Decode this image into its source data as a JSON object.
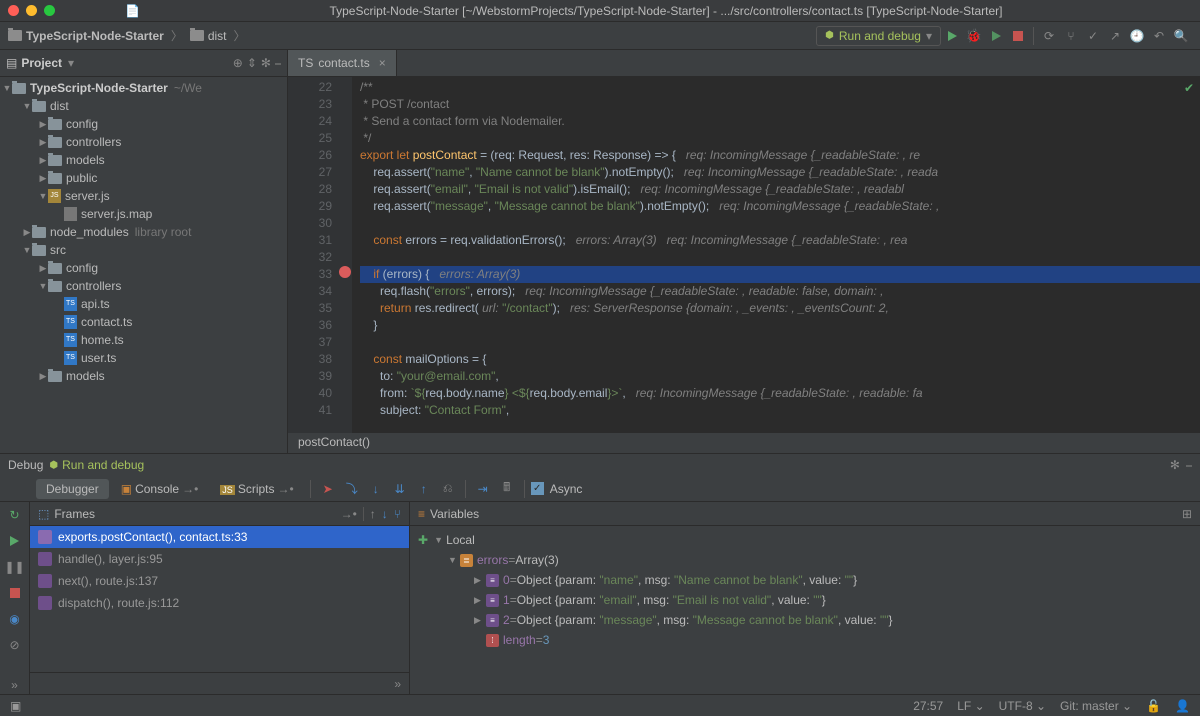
{
  "window": {
    "title": "TypeScript-Node-Starter [~/WebstormProjects/TypeScript-Node-Starter] - .../src/controllers/contact.ts [TypeScript-Node-Starter]"
  },
  "breadcrumb": {
    "root": "TypeScript-Node-Starter",
    "sub": "dist"
  },
  "run": {
    "config": "Run and debug",
    "async_label": "Async"
  },
  "sidebar": {
    "title": "Project",
    "root": {
      "label": "TypeScript-Node-Starter",
      "path": "~/We"
    },
    "tree": [
      {
        "depth": 1,
        "arrow": "down",
        "icon": "folder",
        "label": "dist"
      },
      {
        "depth": 2,
        "arrow": "right",
        "icon": "folder",
        "label": "config"
      },
      {
        "depth": 2,
        "arrow": "right",
        "icon": "folder",
        "label": "controllers"
      },
      {
        "depth": 2,
        "arrow": "right",
        "icon": "folder",
        "label": "models"
      },
      {
        "depth": 2,
        "arrow": "right",
        "icon": "folder",
        "label": "public"
      },
      {
        "depth": 2,
        "arrow": "down",
        "icon": "js",
        "label": "server.js"
      },
      {
        "depth": 3,
        "arrow": "",
        "icon": "file",
        "label": "server.js.map"
      },
      {
        "depth": 1,
        "arrow": "right",
        "icon": "folder",
        "label": "node_modules",
        "suffix": "library root"
      },
      {
        "depth": 1,
        "arrow": "down",
        "icon": "folder",
        "label": "src"
      },
      {
        "depth": 2,
        "arrow": "right",
        "icon": "folder",
        "label": "config"
      },
      {
        "depth": 2,
        "arrow": "down",
        "icon": "folder",
        "label": "controllers"
      },
      {
        "depth": 3,
        "arrow": "",
        "icon": "ts",
        "label": "api.ts"
      },
      {
        "depth": 3,
        "arrow": "",
        "icon": "ts",
        "label": "contact.ts"
      },
      {
        "depth": 3,
        "arrow": "",
        "icon": "ts",
        "label": "home.ts"
      },
      {
        "depth": 3,
        "arrow": "",
        "icon": "ts",
        "label": "user.ts"
      },
      {
        "depth": 2,
        "arrow": "right",
        "icon": "folder",
        "label": "models"
      }
    ]
  },
  "editor": {
    "tab": "contact.ts",
    "first_line": 22,
    "crumb": "postContact()",
    "lines": [
      {
        "n": 22,
        "html": "<span class='c-cm'>/**</span>"
      },
      {
        "n": 23,
        "html": "<span class='c-cm'> * POST /contact</span>"
      },
      {
        "n": 24,
        "html": "<span class='c-cm'> * Send a contact form via Nodemailer.</span>"
      },
      {
        "n": 25,
        "html": "<span class='c-cm'> */</span>"
      },
      {
        "n": 26,
        "html": "<span class='c-kw'>export let</span> <span class='c-fn'>postContact</span> = (req: Request, res: Response) =&gt; {   <span class='c-hint'>req: IncomingMessage {_readableState: , re</span>"
      },
      {
        "n": 27,
        "html": "    req.assert(<span class='c-str'>\"name\"</span>, <span class='c-str'>\"Name cannot be blank\"</span>).notEmpty();   <span class='c-hint'>req: IncomingMessage {_readableState: , reada</span>"
      },
      {
        "n": 28,
        "html": "    req.assert(<span class='c-str'>\"email\"</span>, <span class='c-str'>\"Email is not valid\"</span>).isEmail();   <span class='c-hint'>req: IncomingMessage {_readableState: , readabl</span>"
      },
      {
        "n": 29,
        "html": "    req.assert(<span class='c-str'>\"message\"</span>, <span class='c-str'>\"Message cannot be blank\"</span>).notEmpty();   <span class='c-hint'>req: IncomingMessage {_readableState: ,</span>"
      },
      {
        "n": 30,
        "html": ""
      },
      {
        "n": 31,
        "html": "    <span class='c-kw'>const</span> errors = req.validationErrors();   <span class='c-hint'>errors: Array(3)   req: IncomingMessage {_readableState: , rea</span>"
      },
      {
        "n": 32,
        "html": ""
      },
      {
        "n": 33,
        "hl": true,
        "html": "    <span class='c-kw'>if</span> (errors) {   <span class='c-hint'>errors: Array(3)</span>"
      },
      {
        "n": 34,
        "html": "      req.flash(<span class='c-str'>\"errors\"</span>, errors);   <span class='c-hint'>req: IncomingMessage {_readableState: , readable: false, domain: ,</span>"
      },
      {
        "n": 35,
        "html": "      <span class='c-kw'>return</span> res.redirect( <span class='c-hint'>url:</span> <span class='c-str'>\"/contact\"</span>);   <span class='c-hint'>res: ServerResponse {domain: , _events: , _eventsCount: 2,</span>"
      },
      {
        "n": 36,
        "html": "    }"
      },
      {
        "n": 37,
        "html": ""
      },
      {
        "n": 38,
        "html": "    <span class='c-kw'>const</span> mailOptions = {"
      },
      {
        "n": 39,
        "html": "      to: <span class='c-str'>\"your@email.com\"</span>,"
      },
      {
        "n": 40,
        "html": "      from: <span class='c-str'>`${</span>req.body.name<span class='c-str'>} &lt;${</span>req.body.email<span class='c-str'>}&gt;`</span>,   <span class='c-hint'>req: IncomingMessage {_readableState: , readable: fa</span>"
      },
      {
        "n": 41,
        "html": "      subject: <span class='c-str'>\"Contact Form\"</span>,"
      }
    ]
  },
  "debug": {
    "title": "Debug",
    "config": "Run and debug",
    "tabs": {
      "debugger": "Debugger",
      "console": "Console",
      "scripts": "Scripts"
    },
    "frames": {
      "title": "Frames",
      "rows": [
        {
          "sel": true,
          "label": "exports.postContact(), contact.ts:33"
        },
        {
          "sel": false,
          "label": "handle(), layer.js:95"
        },
        {
          "sel": false,
          "label": "next(), route.js:137"
        },
        {
          "sel": false,
          "label": "dispatch(), route.js:112"
        }
      ]
    },
    "variables": {
      "title": "Variables",
      "local": "Local",
      "errors_label": "errors",
      "errors_val": "Array(3)",
      "items": [
        {
          "idx": "0",
          "text": "Object {param: \"name\", msg: \"Name cannot be blank\", value: \"\"}"
        },
        {
          "idx": "1",
          "text": "Object {param: \"email\", msg: \"Email is not valid\", value: \"\"}"
        },
        {
          "idx": "2",
          "text": "Object {param: \"message\", msg: \"Message cannot be blank\", value: \"\"}"
        }
      ],
      "length_label": "length",
      "length_val": "3"
    }
  },
  "status": {
    "pos": "27:57",
    "sep": "LF",
    "enc": "UTF-8",
    "git": "Git: master"
  }
}
